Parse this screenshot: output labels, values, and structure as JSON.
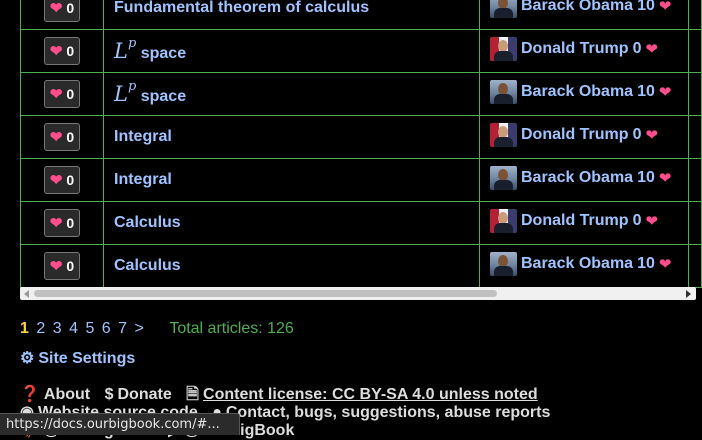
{
  "rows": [
    {
      "likes": "0",
      "title_text": "Fundamental theorem of calculus",
      "title_math": "",
      "author": "Barack Obama",
      "author_score": "10",
      "avatar": "obama"
    },
    {
      "likes": "0",
      "title_text": "space",
      "title_math": "L",
      "title_sup": "p",
      "author": "Donald Trump",
      "author_score": "0",
      "avatar": "trump"
    },
    {
      "likes": "0",
      "title_text": "space",
      "title_math": "L",
      "title_sup": "p",
      "author": "Barack Obama",
      "author_score": "10",
      "avatar": "obama"
    },
    {
      "likes": "0",
      "title_text": "Integral",
      "title_math": "",
      "author": "Donald Trump",
      "author_score": "0",
      "avatar": "trump"
    },
    {
      "likes": "0",
      "title_text": "Integral",
      "title_math": "",
      "author": "Barack Obama",
      "author_score": "10",
      "avatar": "obama"
    },
    {
      "likes": "0",
      "title_text": "Calculus",
      "title_math": "",
      "author": "Donald Trump",
      "author_score": "0",
      "avatar": "trump"
    },
    {
      "likes": "0",
      "title_text": "Calculus",
      "title_math": "",
      "author": "Barack Obama",
      "author_score": "10",
      "avatar": "obama"
    }
  ],
  "pagination": {
    "current": "1",
    "pages": [
      "2",
      "3",
      "4",
      "5",
      "6",
      "7"
    ],
    "next": ">",
    "total_label": "Total articles: 126"
  },
  "site_settings": "Site Settings",
  "footer": {
    "about": "About",
    "donate": "Donate",
    "license": "Content license: CC BY-SA 4.0 unless noted",
    "source": "Website source code",
    "contact": "Contact, bugs, suggestions, abuse reports",
    "twitter": "@OurBigBook",
    "youtube": "@OurBigBook"
  },
  "status_url": "https://docs.ourbigbook.com/#...",
  "colors": {
    "accent": "#9ec3ff",
    "border": "#4caf50",
    "heart": "#ff4d8d",
    "current_page": "#ffd23f"
  },
  "icons": {
    "like": "heart-icon",
    "about": "help-circle-icon",
    "donate": "dollar-icon",
    "license": "document-icon",
    "source": "github-icon",
    "contact": "comment-icon",
    "twitter": "twitter-icon",
    "youtube": "youtube-icon",
    "settings": "gear-icon"
  }
}
